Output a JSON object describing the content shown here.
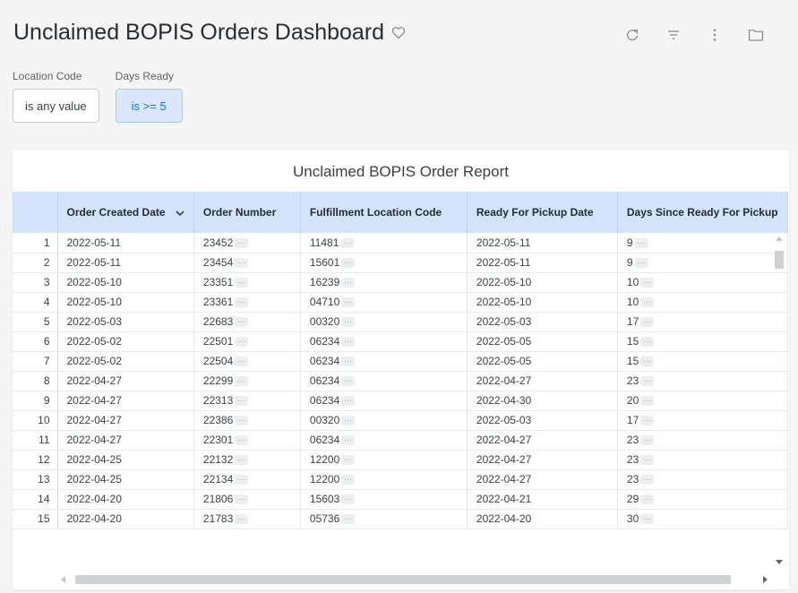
{
  "dashboard": {
    "title": "Unclaimed BOPIS Orders Dashboard",
    "icons": [
      "heart-outline-icon",
      "refresh-icon",
      "filter-icon",
      "more-vert-icon",
      "folder-icon"
    ]
  },
  "filters": [
    {
      "label": "Location Code",
      "value": "is any value",
      "active": false
    },
    {
      "label": "Days Ready",
      "value": "is >= 5",
      "active": true
    }
  ],
  "report": {
    "title": "Unclaimed BOPIS Order Report",
    "columns": [
      "Order Created Date",
      "Order Number",
      "Fulfillment Location Code",
      "Ready For Pickup Date",
      "Days Since Ready For Pickup"
    ],
    "sort_icon": "chevron-down-icon",
    "ellipsis": "···",
    "rows": [
      {
        "n": "1",
        "created": "2022-05-11",
        "order": "23452",
        "loc": "11481",
        "ready": "2022-05-11",
        "days": "9"
      },
      {
        "n": "2",
        "created": "2022-05-11",
        "order": "23454",
        "loc": "15601",
        "ready": "2022-05-11",
        "days": "9"
      },
      {
        "n": "3",
        "created": "2022-05-10",
        "order": "23351",
        "loc": "16239",
        "ready": "2022-05-10",
        "days": "10"
      },
      {
        "n": "4",
        "created": "2022-05-10",
        "order": "23361",
        "loc": "04710",
        "ready": "2022-05-10",
        "days": "10"
      },
      {
        "n": "5",
        "created": "2022-05-03",
        "order": "22683",
        "loc": "00320",
        "ready": "2022-05-03",
        "days": "17"
      },
      {
        "n": "6",
        "created": "2022-05-02",
        "order": "22501",
        "loc": "06234",
        "ready": "2022-05-05",
        "days": "15"
      },
      {
        "n": "7",
        "created": "2022-05-02",
        "order": "22504",
        "loc": "06234",
        "ready": "2022-05-05",
        "days": "15"
      },
      {
        "n": "8",
        "created": "2022-04-27",
        "order": "22299",
        "loc": "06234",
        "ready": "2022-04-27",
        "days": "23"
      },
      {
        "n": "9",
        "created": "2022-04-27",
        "order": "22313",
        "loc": "06234",
        "ready": "2022-04-30",
        "days": "20"
      },
      {
        "n": "10",
        "created": "2022-04-27",
        "order": "22386",
        "loc": "00320",
        "ready": "2022-05-03",
        "days": "17"
      },
      {
        "n": "11",
        "created": "2022-04-27",
        "order": "22301",
        "loc": "06234",
        "ready": "2022-04-27",
        "days": "23"
      },
      {
        "n": "12",
        "created": "2022-04-25",
        "order": "22132",
        "loc": "12200",
        "ready": "2022-04-27",
        "days": "23"
      },
      {
        "n": "13",
        "created": "2022-04-25",
        "order": "22134",
        "loc": "12200",
        "ready": "2022-04-27",
        "days": "23"
      },
      {
        "n": "14",
        "created": "2022-04-20",
        "order": "21806",
        "loc": "15603",
        "ready": "2022-04-21",
        "days": "29"
      },
      {
        "n": "15",
        "created": "2022-04-20",
        "order": "21783",
        "loc": "05736",
        "ready": "2022-04-20",
        "days": "30"
      }
    ]
  }
}
